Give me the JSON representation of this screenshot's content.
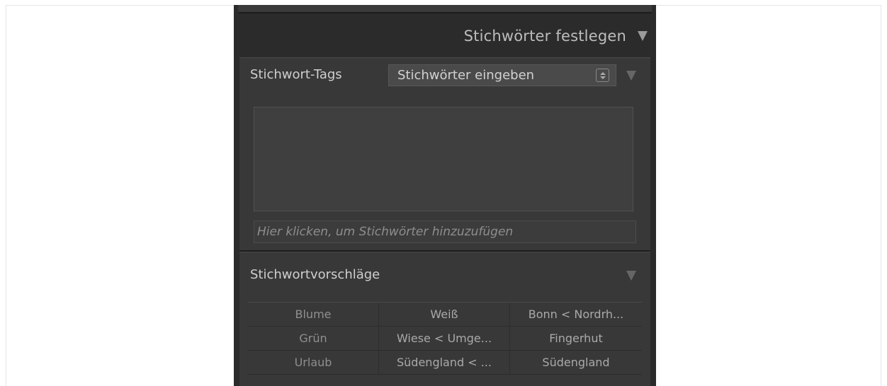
{
  "panel": {
    "title": "Stichwörter festlegen"
  },
  "keyword_tags": {
    "label": "Stichwort-Tags",
    "select_value": "Stichwörter eingeben",
    "input_placeholder": "Hier klicken, um Stichwörter hinzuzufügen"
  },
  "suggestions": {
    "label": "Stichwortvorschläge",
    "items": [
      "Blume",
      "Weiß",
      "Bonn < Nordrh...",
      "Grün",
      "Wiese < Umge...",
      "Fingerhut",
      "Urlaub",
      "Südengland < ...",
      "Südengland"
    ]
  },
  "icons": {
    "collapse": "triangle-down-icon",
    "stepper": "up-down-stepper-icon"
  },
  "colors": {
    "panel_bg": "#2b2b2b",
    "section_bg": "#383838",
    "text": "#cfcfcf",
    "muted_text": "#8f8f8f"
  }
}
